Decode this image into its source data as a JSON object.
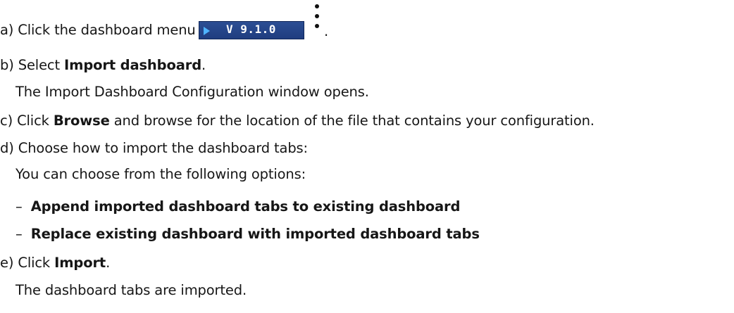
{
  "steps": [
    {
      "prefix": "a) Click the dashboard menu icon",
      "suffix": "."
    },
    {
      "prefix": "b) Select ",
      "bold": "Import dashboard",
      "suffix": ".",
      "note": "The Import Dashboard Configuration window opens."
    },
    {
      "prefix": "c) Click ",
      "bold": "Browse",
      "suffix": " and browse for the location of the file that contains your configuration."
    },
    {
      "text": "d) Choose how to import the dashboard tabs:",
      "note": "You can choose from the following options:",
      "options": [
        "Append imported dashboard tabs to existing dashboard",
        "Replace existing dashboard with imported dashboard tabs"
      ],
      "option_bullet": "–"
    },
    {
      "prefix": "e) Click ",
      "bold": "Import",
      "suffix": ".",
      "note": "The dashboard tabs are imported."
    }
  ],
  "menu_icon_image": {
    "version_label": "V 9.1.0",
    "icon": "kebab-menu-icon",
    "colors": {
      "background": "#1f3d7f",
      "arrow": "#4fb4ff",
      "text": "#ffffff"
    }
  }
}
